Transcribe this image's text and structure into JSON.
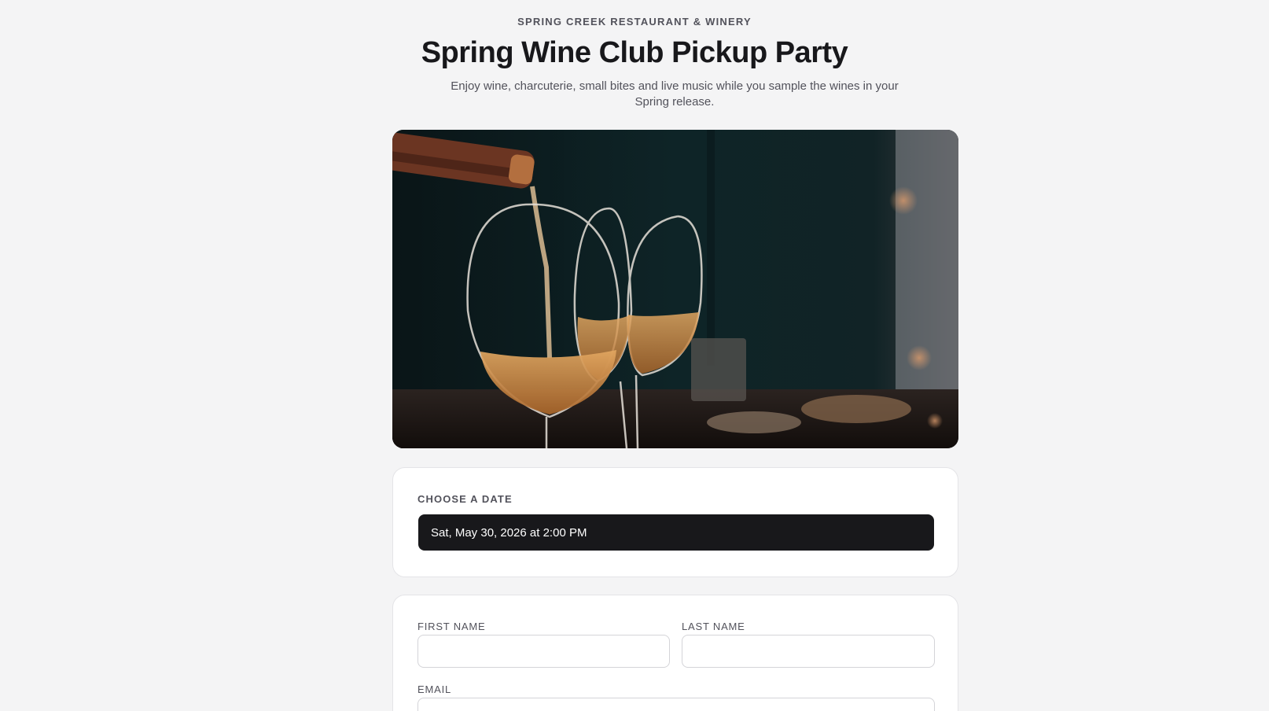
{
  "header": {
    "eyebrow": "SPRING CREEK RESTAURANT & WINERY",
    "title": "Spring Wine Club Pickup Party",
    "subtitle": "Enjoy wine, charcuterie, small bites and live music while you sample the wines in your Spring release."
  },
  "hero_image": {
    "icon": "wine-pour-photo"
  },
  "date_section": {
    "label": "CHOOSE A DATE",
    "selected_date": "Sat, May 30, 2026 at 2:00 PM"
  },
  "form": {
    "first_name": {
      "label": "FIRST NAME",
      "value": "",
      "placeholder": ""
    },
    "last_name": {
      "label": "LAST NAME",
      "value": "",
      "placeholder": ""
    },
    "email": {
      "label": "EMAIL",
      "value": "",
      "placeholder": ""
    }
  },
  "colors": {
    "background": "#f4f4f5",
    "card": "#ffffff",
    "primary_button": "#18181b",
    "text_muted": "#52525b"
  }
}
